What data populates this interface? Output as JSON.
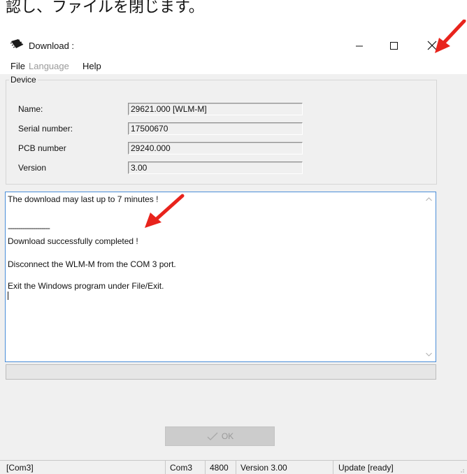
{
  "caption": {
    "text": "認し、ファイルを閉じます。"
  },
  "window": {
    "title": "Download :",
    "controls": {
      "minimize": "minimize-icon",
      "maximize": "maximize-icon",
      "close": "close-icon"
    }
  },
  "menu": [
    {
      "label": "File",
      "enabled": true
    },
    {
      "label": "Language",
      "enabled": false
    },
    {
      "label": "Help",
      "enabled": true
    }
  ],
  "device": {
    "legend": "Device",
    "fields": [
      {
        "label": "Name:",
        "value": "29621.000  [WLM-M]"
      },
      {
        "label": "Serial number:",
        "value": "17500670"
      },
      {
        "label": "PCB number",
        "value": "29240.000"
      },
      {
        "label": "Version",
        "value": "3.00"
      }
    ]
  },
  "log": {
    "lines": [
      "The download may last up to 7 minutes !",
      "",
      "--------------------",
      "Download successfully completed !",
      "",
      "Disconnect the WLM-M from the COM 3 port.",
      "",
      "Exit the Windows program under File/Exit."
    ]
  },
  "progress": {
    "fraction": 0.0
  },
  "ok_button": {
    "label": "OK",
    "enabled": false,
    "icon": "checkmark-icon"
  },
  "status": {
    "port": "[Com3]",
    "com": "Com3",
    "baud": "4800",
    "version": "Version  3.00",
    "update": "Update [ready]"
  },
  "colors": {
    "annotation_arrow": "#e8231c",
    "log_border": "#4b8ed8",
    "window_bg": "#f0f0f0"
  }
}
